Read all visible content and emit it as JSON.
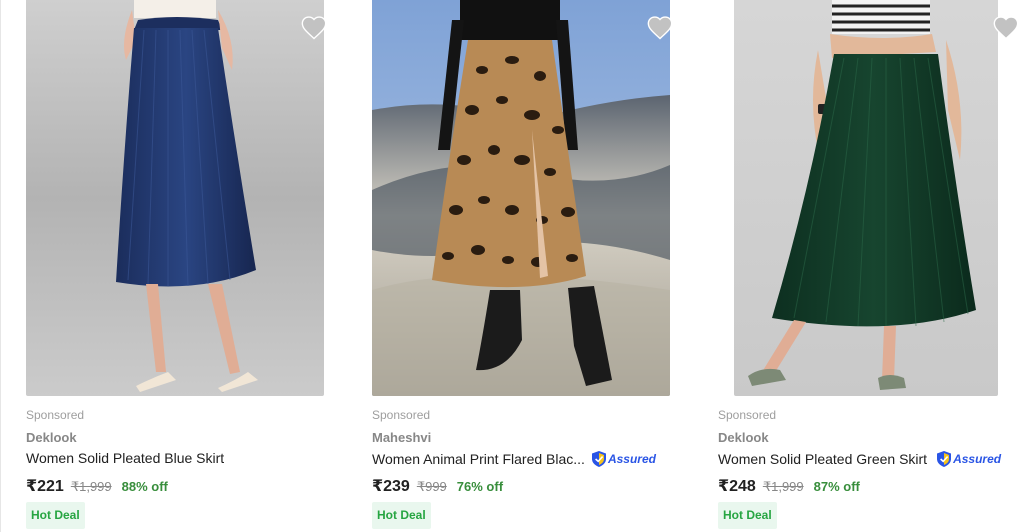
{
  "products": [
    {
      "sponsored": "Sponsored",
      "brand": "Deklook",
      "title": "Women Solid Pleated Blue Skirt",
      "assured": "",
      "price": "₹221",
      "mrp": "₹1,999",
      "discount": "88% off",
      "badge": "Hot Deal",
      "image": "blue-pleated-skirt-image",
      "skirt_color": "#233a6e"
    },
    {
      "sponsored": "Sponsored",
      "brand": "Maheshvi",
      "title": "Women Animal Print Flared Blac...",
      "assured": "Assured",
      "price": "₹239",
      "mrp": "₹999",
      "discount": "76% off",
      "badge": "Hot Deal",
      "image": "leopard-print-skirt-image",
      "skirt_color": "#b88a55"
    },
    {
      "sponsored": "Sponsored",
      "brand": "Deklook",
      "title": "Women Solid Pleated Green Skirt",
      "assured": "Assured",
      "price": "₹248",
      "mrp": "₹1,999",
      "discount": "87% off",
      "badge": "Hot Deal",
      "image": "green-pleated-skirt-image",
      "skirt_color": "#123b2a"
    }
  ],
  "colors": {
    "discount_green": "#388e3c",
    "hot_deal_text": "#26a541",
    "hot_deal_bg": "#e9f7ee",
    "wishlist_heart": "#c2c2c2",
    "assured_blue": "#2a55e5"
  }
}
